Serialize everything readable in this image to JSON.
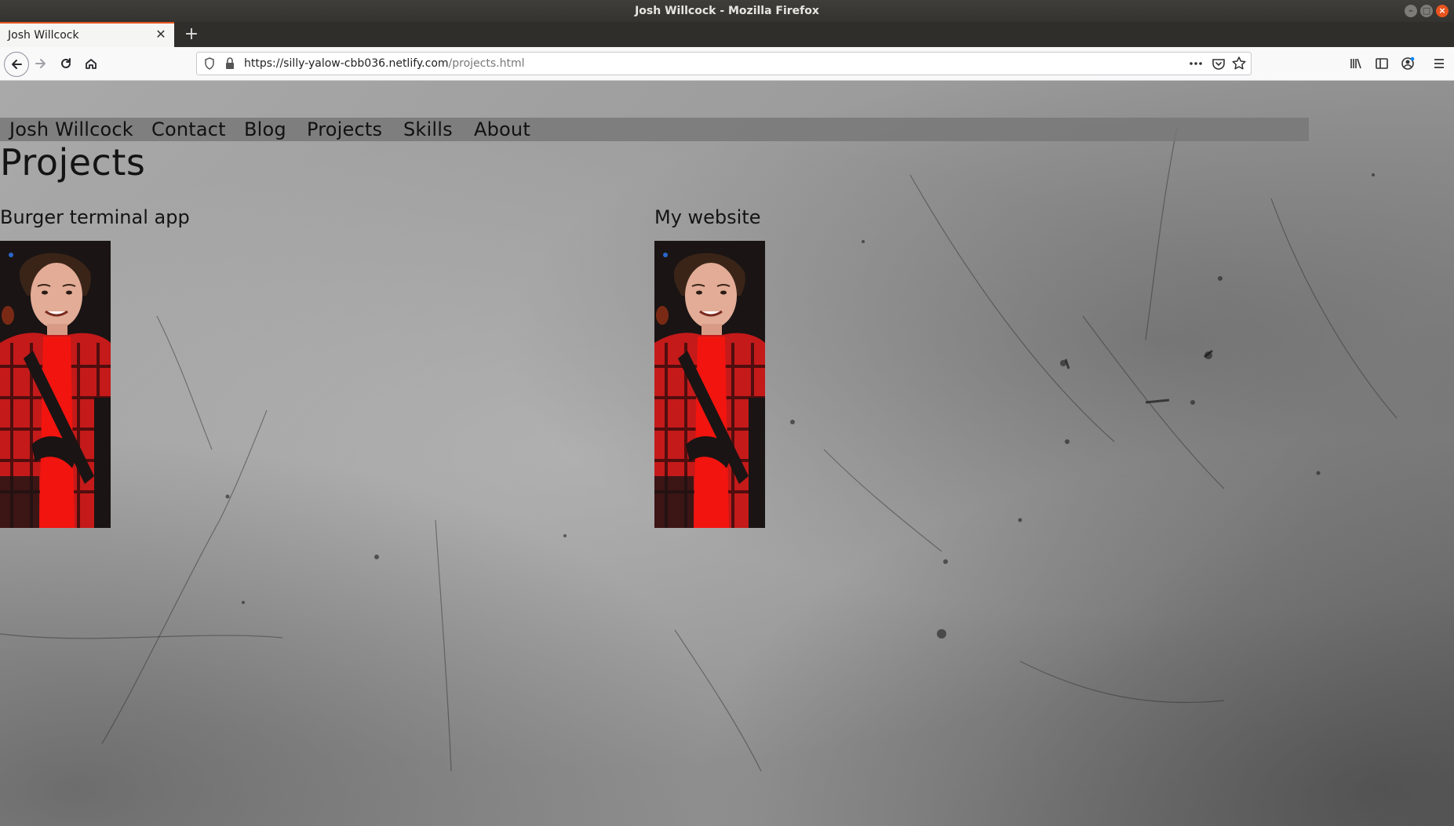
{
  "window": {
    "title": "Josh Willcock - Mozilla Firefox"
  },
  "browser": {
    "tab": {
      "title": "Josh Willcock"
    },
    "url": {
      "host": "https://silly-yalow-cbb036.netlify.com",
      "path": "/projects.html"
    },
    "accent_color": "#e95420"
  },
  "site": {
    "nav": {
      "brand": "Josh Willcock",
      "items": [
        "Contact",
        "Blog",
        "Projects",
        "Skills",
        "About"
      ]
    },
    "page_title": "Projects",
    "projects": [
      {
        "title": "Burger terminal app",
        "image": "profile-photo"
      },
      {
        "title": "My website",
        "image": "profile-photo"
      }
    ]
  }
}
